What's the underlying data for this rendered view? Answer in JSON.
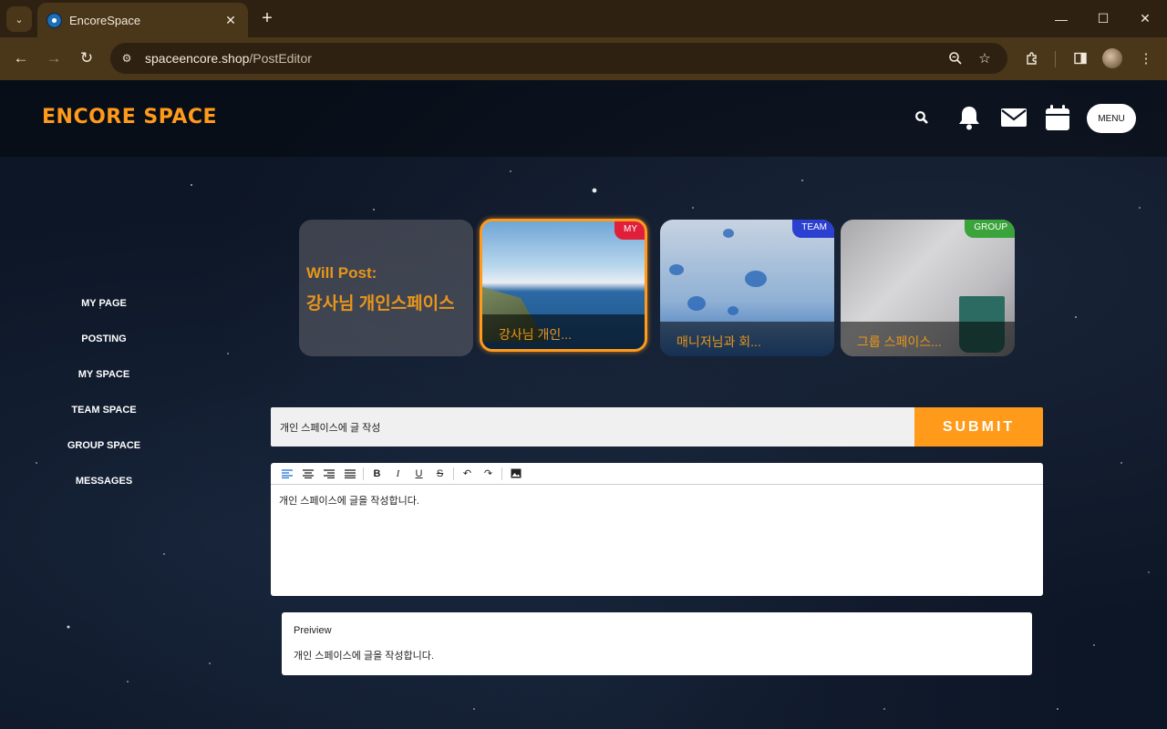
{
  "browser": {
    "tab_title": "EncoreSpace",
    "url_host": "spaceencore.shop",
    "url_path": "/PostEditor"
  },
  "header": {
    "brand": "ENCORE SPACE",
    "menu_label": "MENU"
  },
  "sidenav": {
    "items": [
      "MY PAGE",
      "POSTING",
      "MY SPACE",
      "TEAM SPACE",
      "GROUP SPACE",
      "MESSAGES"
    ]
  },
  "cards": {
    "will_post_label": "Will Post:",
    "will_post_target": "강사님 개인스페이스",
    "my": {
      "badge": "MY",
      "caption": "강사님 개인..."
    },
    "team": {
      "badge": "TEAM",
      "caption": "매니저님과 회..."
    },
    "group": {
      "badge": "GROUP",
      "caption": "그룹 스페이스..."
    }
  },
  "post": {
    "title_value": "개인 스페이스에 글 작성",
    "submit_label": "SUBMIT",
    "body_text": "개인 스페이스에 글을 작성합니다."
  },
  "preview": {
    "title": "Preiview",
    "text": "개인 스페이스에 글을 작성합니다."
  },
  "colors": {
    "accent": "#ff9a1a",
    "badge_my": "#e0203a",
    "badge_team": "#2b3fd0",
    "badge_group": "#3aa33a"
  }
}
